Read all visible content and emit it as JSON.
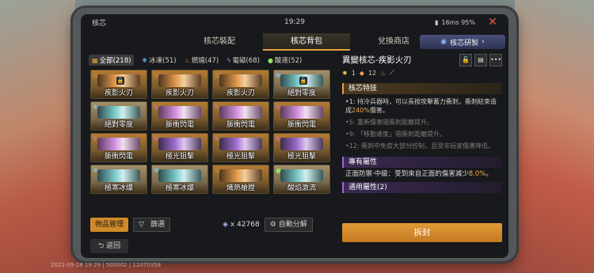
{
  "window": {
    "title": "核芯",
    "time": "19:29",
    "signal_status": "16ms 95%",
    "close_label": "✕"
  },
  "tabs": [
    {
      "label": "核芯裝配"
    },
    {
      "label": "核芯背包"
    },
    {
      "label": "兌換商店"
    }
  ],
  "active_tab": "核芯背包",
  "tab_status": "16ms 95%",
  "research_button": "核芯研製",
  "filters": [
    {
      "label": "全部(218)"
    },
    {
      "label": "冰凍(51)"
    },
    {
      "label": "燃燒(47)"
    },
    {
      "label": "電磁(68)"
    },
    {
      "label": "酸液(52)"
    }
  ],
  "items": [
    {
      "label": "疾影火刃"
    },
    {
      "label": "疾影火刃"
    },
    {
      "label": "疾影火刃"
    },
    {
      "label": "絕對零度"
    },
    {
      "label": "絕對零度"
    },
    {
      "label": "脈衝閃電"
    },
    {
      "label": "脈衝閃電"
    },
    {
      "label": "脈衝閃電"
    },
    {
      "label": "脈衝閃電"
    },
    {
      "label": "極光狙擊"
    },
    {
      "label": "極光狙擊"
    },
    {
      "label": "極光狙擊"
    },
    {
      "label": "極寒冰爆"
    },
    {
      "label": "極寒冰爆"
    },
    {
      "label": "熾熱槍膛"
    },
    {
      "label": "酸焰激流"
    }
  ],
  "bottom": {
    "manage_label": "物品管理",
    "filter_label": "篩選",
    "currency_value": "x 42768",
    "auto_label": "自動分解"
  },
  "back_label": "返回",
  "detail": {
    "title": "異變核芯-疾影火刃",
    "stars": "1",
    "level": "12",
    "section_skill": "核芯特技",
    "skill_1_a": "•1: 持冷兵器時，可以長按攻擊蓄力衝刺，衝刺結束造成",
    "skill_1_hl": "240%",
    "skill_1_b": "傷害。",
    "skill_5": "•5: 重新傷害隨衝刺距離提升。",
    "skill_9": "•9: 「移動速度」隨衝刺距離提升。",
    "skill_12": "•12: 衝刺中免疫大部分控制，且受非玩家傷害降低。",
    "section_exclusive": "專有屬性",
    "exclusive_a": "正面防禦·中級：受到來自正面的傷害減少",
    "exclusive_hl": "8.0%",
    "exclusive_b": "。",
    "section_general": "通用屬性(2)",
    "unseal_label": "拆封"
  },
  "watermark": "2022-09-28 19:29 | 500002 | 12070358"
}
